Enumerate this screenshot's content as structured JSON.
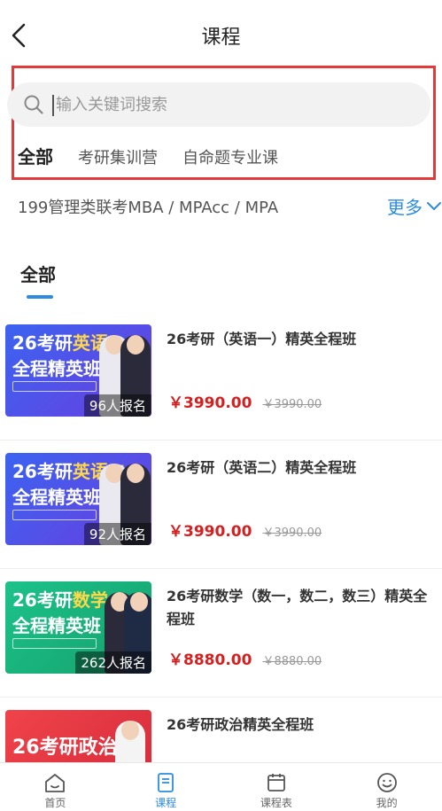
{
  "header": {
    "title": "课程",
    "back_icon": "chevron-left-icon"
  },
  "search": {
    "placeholder": "输入关键词搜索",
    "value": ""
  },
  "filter_tabs": [
    {
      "label": "全部",
      "active": true
    },
    {
      "label": "考研集训营",
      "active": false
    },
    {
      "label": "自命题专业课",
      "active": false
    }
  ],
  "category": {
    "text": "199管理类联考MBA / MPAcc / MPA",
    "more_label": "更多"
  },
  "section": {
    "title": "全部"
  },
  "courses": [
    {
      "title": "26考研（英语一）精英全程班",
      "thumb_line1": "26考研",
      "thumb_highlight": "英语一",
      "thumb_line2": "全程精英班",
      "enroll": "96人报名",
      "price": "￥3990.00",
      "orig_price": "￥3990.00",
      "thumb_color": "#3a55e6"
    },
    {
      "title": "26考研（英语二）精英全程班",
      "thumb_line1": "26考研",
      "thumb_highlight": "英语二",
      "thumb_line2": "全程精英班",
      "enroll": "92人报名",
      "price": "￥3990.00",
      "orig_price": "￥3990.00",
      "thumb_color": "#3a55e6"
    },
    {
      "title": "26考研数学（数一，数二，数三）精英全程班",
      "thumb_line1": "26考研",
      "thumb_highlight": "数学",
      "thumb_line2": "全程精英班",
      "enroll": "262人报名",
      "price": "￥8880.00",
      "orig_price": "￥8880.00",
      "thumb_color": "#19b27a"
    },
    {
      "title": "26考研政治精英全程班",
      "thumb_line1": "26考研政治",
      "thumb_highlight": "",
      "thumb_line2": "",
      "enroll": "",
      "price": "",
      "orig_price": "",
      "thumb_color": "#e23a3a"
    }
  ],
  "bottom_nav": [
    {
      "label": "首页",
      "icon": "home-icon",
      "active": false
    },
    {
      "label": "课程",
      "icon": "course-book-icon",
      "active": true
    },
    {
      "label": "课程表",
      "icon": "calendar-icon",
      "active": false
    },
    {
      "label": "我的",
      "icon": "smiley-profile-icon",
      "active": false
    }
  ],
  "colors": {
    "accent": "#2c8ce0",
    "price": "#d42020",
    "highlight_border": "#e23a3a"
  }
}
